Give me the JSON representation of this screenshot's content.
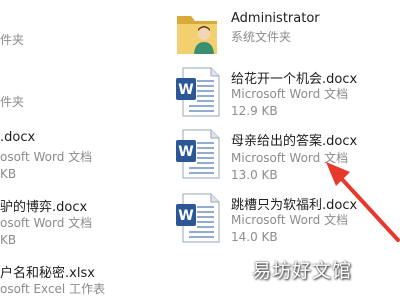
{
  "left_column": [
    {
      "name": "",
      "type": "件夹",
      "size": ""
    },
    {
      "name": "",
      "type": "件夹",
      "size": ""
    },
    {
      "name": ".docx",
      "type": "osoft Word 文档",
      "size": "KB"
    },
    {
      "name": "驴的博弈.docx",
      "type": "osoft Word 文档",
      "size": "KB"
    },
    {
      "name": "户名和秘密.xlsx",
      "type": "osoft Excel 工作表",
      "size": ""
    }
  ],
  "right_column": [
    {
      "name": "Administrator",
      "type": "系统文件夹",
      "size": "",
      "icon": "user-folder-icon"
    },
    {
      "name": "给花开一个机会.docx",
      "type": "Microsoft Word 文档",
      "size": "12.9 KB",
      "icon": "word-doc-icon"
    },
    {
      "name": "母亲给出的答案.docx",
      "type": "Microsoft Word 文档",
      "size": "13.0 KB",
      "icon": "word-doc-icon"
    },
    {
      "name": "跳槽只为软福利.docx",
      "type": "Microsoft Word 文档",
      "size": "14.0 KB",
      "icon": "word-doc-icon"
    }
  ],
  "watermark": "易坊好文馆",
  "colors": {
    "annotation_arrow": "#e8382c",
    "word_blue": "#2b5797",
    "folder_yellow": "#e9c46a"
  }
}
